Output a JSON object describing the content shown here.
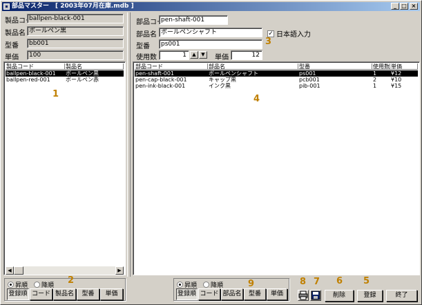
{
  "window": {
    "title": "部品マスター　[ 2003年07月在庫.mdb ]",
    "minimize": "_",
    "maximize": "□",
    "close": "×"
  },
  "product_form": {
    "code_label": "製品コード",
    "code_value": "ballpen-black-001",
    "name_label": "製品名",
    "name_value": "ボールペン黒",
    "model_label": "型番",
    "model_value": "bb001",
    "price_label": "単価",
    "price_value": "100"
  },
  "product_list": {
    "columns": [
      "製品コード",
      "製品名"
    ],
    "rows": [
      {
        "code": "ballpen-black-001",
        "name": "ボールペン黒",
        "selected": true
      },
      {
        "code": "ballpen-red-001",
        "name": "ボールペン赤",
        "selected": false
      }
    ]
  },
  "part_form": {
    "code_label": "部品コード",
    "code_value": "pen-shaft-001",
    "name_label": "部品名",
    "name_value": "ボールペンシャフト",
    "jp_input_label": "日本語入力",
    "jp_input_checked": true,
    "model_label": "型番",
    "model_value": "ps001",
    "qty_label": "使用数",
    "qty_value": "1",
    "price_label": "単価",
    "price_value": "12"
  },
  "part_list": {
    "columns": [
      "部品コード",
      "部品名",
      "型番",
      "使用数",
      "単価"
    ],
    "rows": [
      {
        "code": "pen-shaft-001",
        "name": "ボールペンシャフト",
        "model": "ps001",
        "qty": "1",
        "price": "¥12",
        "selected": true
      },
      {
        "code": "pen-cap-black-001",
        "name": "キャップ黒",
        "model": "pcb001",
        "qty": "2",
        "price": "¥10",
        "selected": false
      },
      {
        "code": "pen-ink-black-001",
        "name": "インク黒",
        "model": "pib-001",
        "qty": "1",
        "price": "¥15",
        "selected": false
      }
    ]
  },
  "left_sort": {
    "asc": "昇順",
    "desc": "降順",
    "asc_selected": true,
    "buttons": [
      "登録順",
      "コード",
      "製品名",
      "型番",
      "単価"
    ],
    "active": 0
  },
  "right_sort": {
    "asc": "昇順",
    "desc": "降順",
    "asc_selected": true,
    "buttons": [
      "登録順",
      "コード",
      "部品名",
      "型番",
      "単価"
    ],
    "active": 0
  },
  "actions": {
    "delete": "削除",
    "register": "登録",
    "exit": "終了",
    "print_icon": "printer-icon",
    "save_icon": "save-icon"
  },
  "annotations": [
    "1",
    "2",
    "3",
    "4",
    "5",
    "6",
    "7",
    "8",
    "9"
  ],
  "colors": {
    "title_start": "#0a246a",
    "title_end": "#a6caf0",
    "annotation": "#c08000",
    "face": "#d4d0c8"
  }
}
